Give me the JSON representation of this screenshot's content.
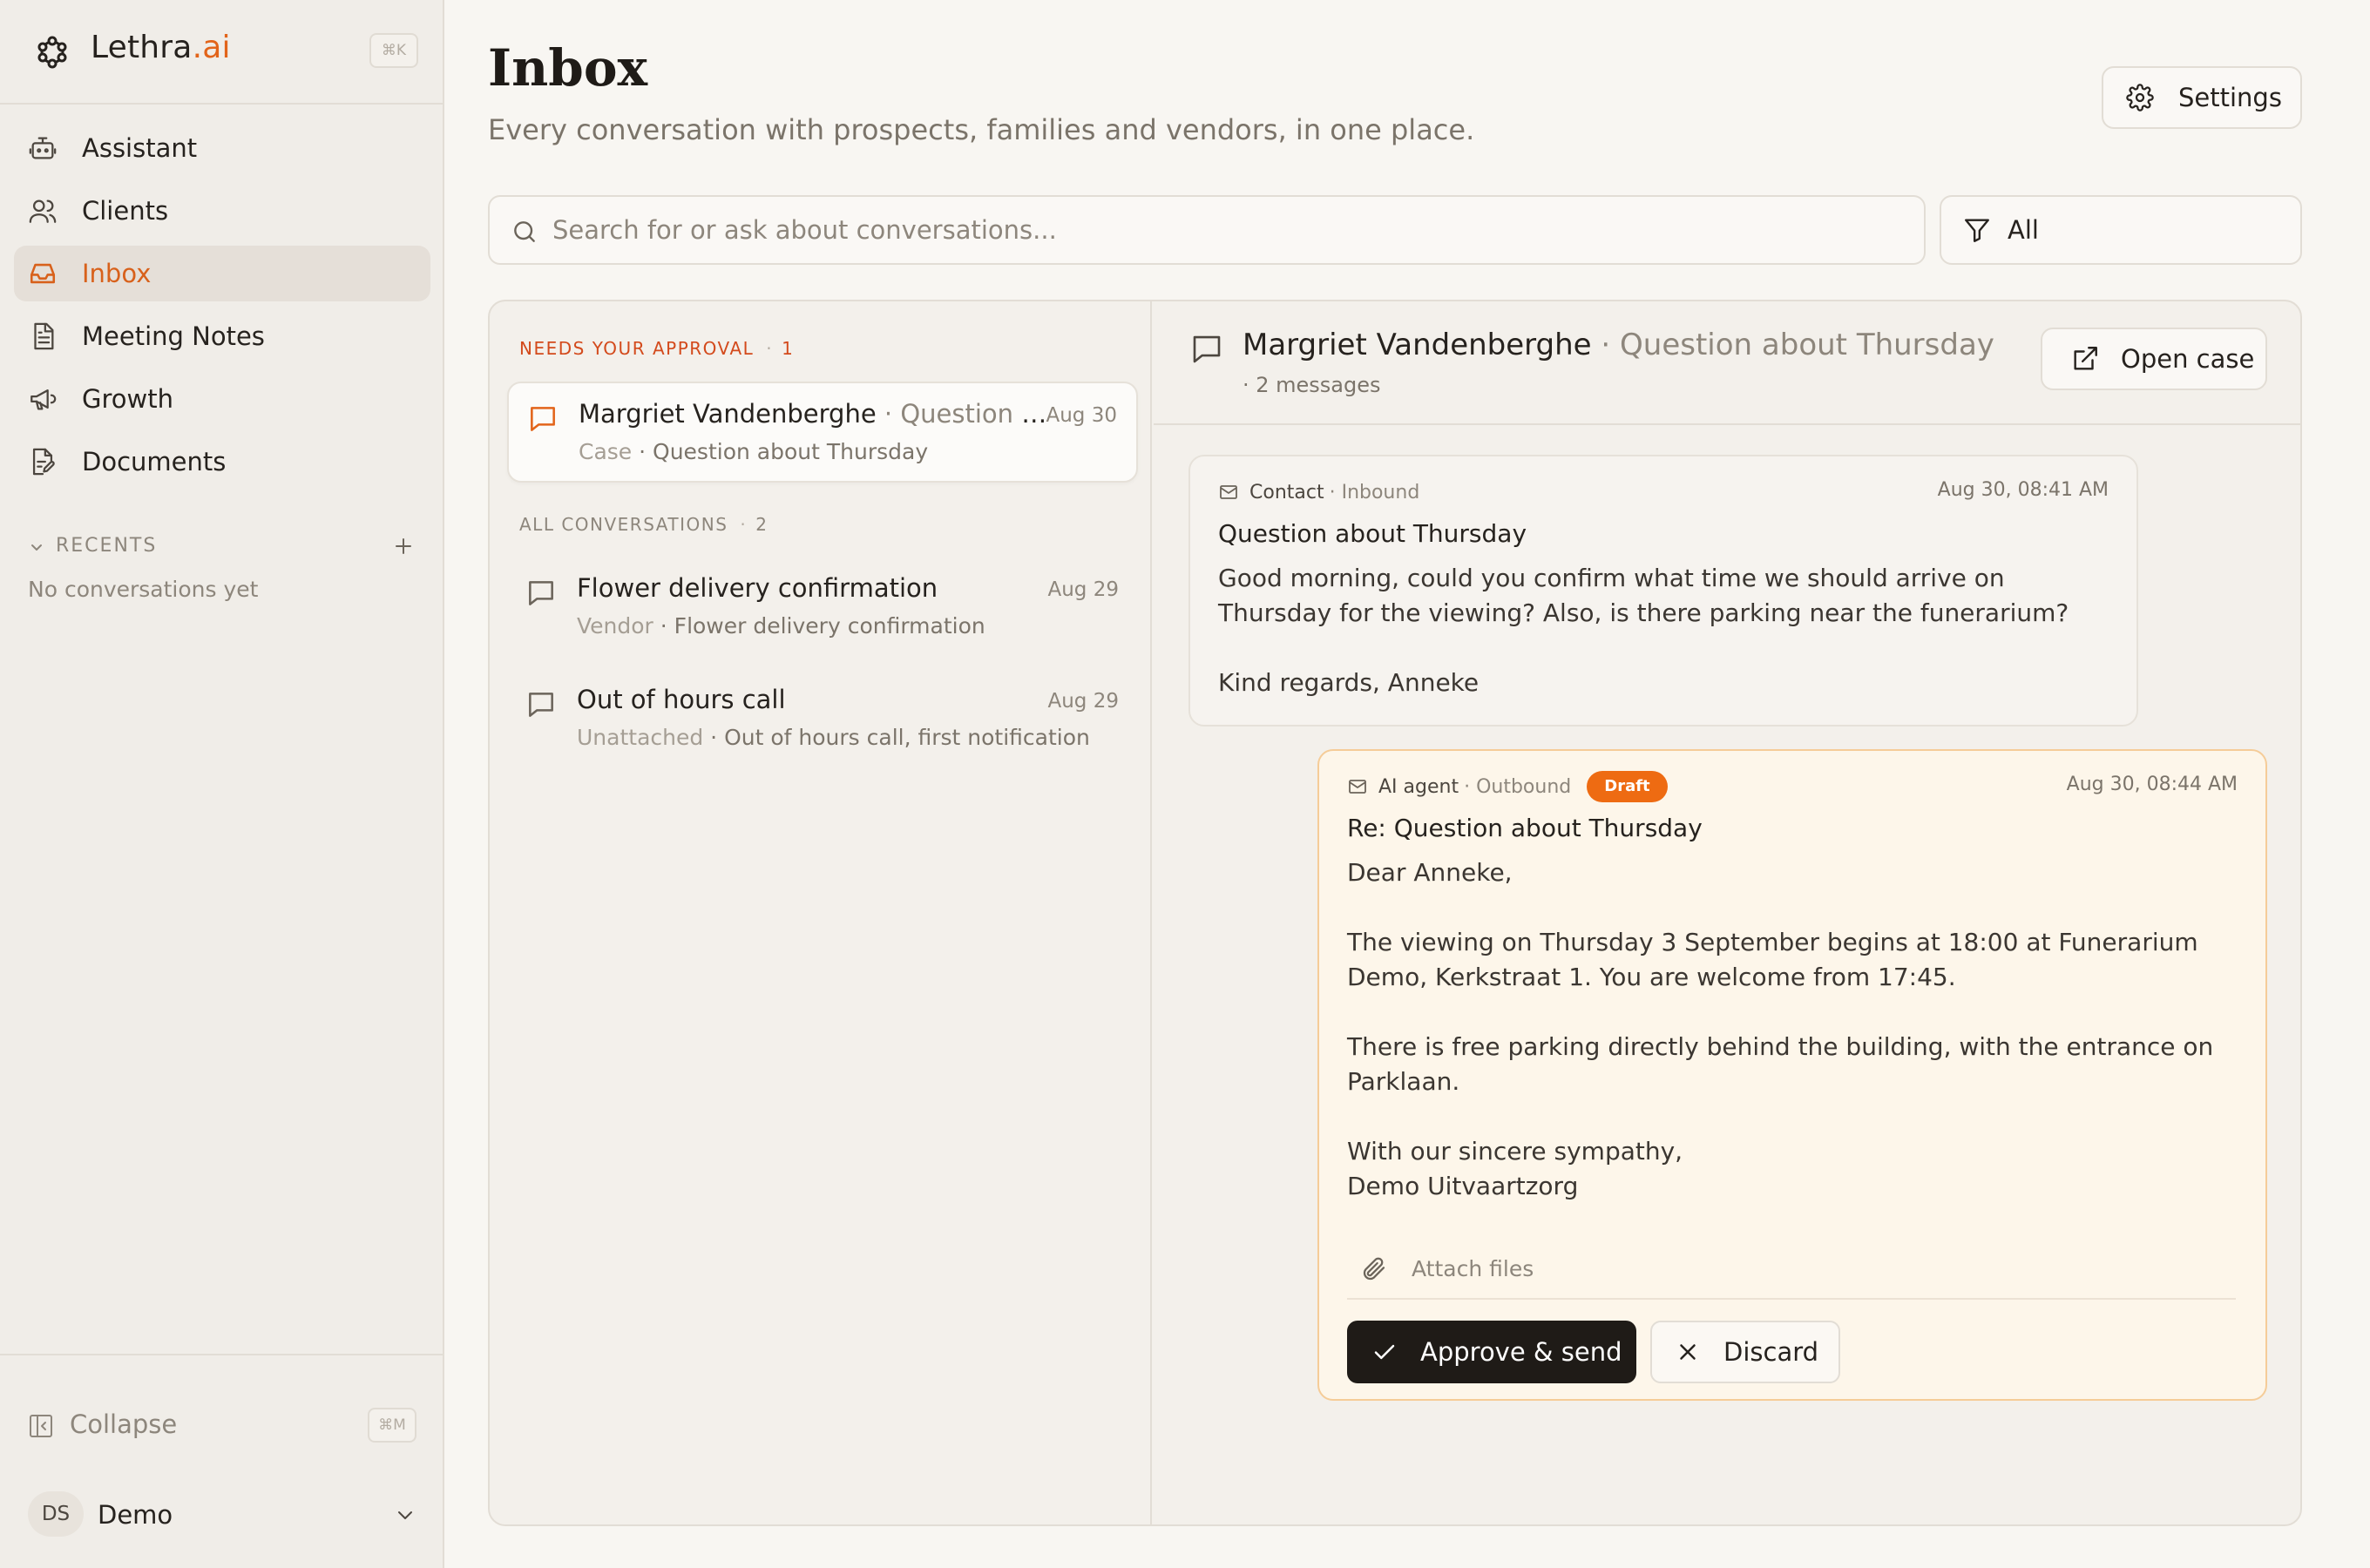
{
  "brand": {
    "name": "Lethra",
    "suffix": ".ai",
    "shortcut": "⌘K",
    "accent_color": "#e2641a"
  },
  "sidebar": {
    "items": [
      {
        "label": "Assistant",
        "icon": "bot-icon",
        "active": false
      },
      {
        "label": "Clients",
        "icon": "users-icon",
        "active": false
      },
      {
        "label": "Inbox",
        "icon": "inbox-icon",
        "active": true
      },
      {
        "label": "Meeting Notes",
        "icon": "document-icon",
        "active": false
      },
      {
        "label": "Growth",
        "icon": "megaphone-icon",
        "active": false
      },
      {
        "label": "Documents",
        "icon": "file-edit-icon",
        "active": false
      }
    ],
    "recents_label": "RECENTS",
    "recents_empty": "No conversations yet",
    "collapse_label": "Collapse",
    "collapse_shortcut": "⌘M",
    "user": {
      "initials": "DS",
      "name": "Demo"
    }
  },
  "header": {
    "title": "Inbox",
    "subtitle": "Every conversation with prospects, families and vendors, in one place.",
    "settings_label": "Settings"
  },
  "search": {
    "placeholder": "Search for or ask about conversations...",
    "value": ""
  },
  "filter": {
    "selected": "All"
  },
  "list": {
    "approval_label": "NEEDS YOUR APPROVAL",
    "approval_sep": "·",
    "approval_count": "1",
    "all_label": "ALL CONVERSATIONS",
    "all_sep": "·",
    "all_count": "2",
    "approval_items": [
      {
        "title": "Margriet Vandenberghe",
        "title_suffix": " · Question about Thursday",
        "date": "Aug 30",
        "type": "Case",
        "sub": " · Question about Thursday"
      }
    ],
    "items": [
      {
        "title": "Flower delivery confirmation",
        "date": "Aug 29",
        "type": "Vendor",
        "sub": " · Flower delivery confirmation"
      },
      {
        "title": "Out of hours call",
        "date": "Aug 29",
        "type": "Unattached",
        "sub": " · Out of hours call, first notification"
      }
    ]
  },
  "detail": {
    "name": "Margriet Vandenberghe",
    "subject_suffix": " · Question about Thursday",
    "message_count": "· 2 messages",
    "open_case_label": "Open case",
    "messages": [
      {
        "from": "Contact",
        "direction": "· Inbound",
        "time": "Aug 30, 08:41 AM",
        "subject": "Question about Thursday",
        "body": "Good morning, could you confirm what time we should arrive on Thursday for the viewing? Also, is there parking near the funerarium?\n\nKind regards, Anneke"
      },
      {
        "from": "AI agent",
        "direction": "· Outbound",
        "badge": "Draft",
        "time": "Aug 30, 08:44 AM",
        "subject": "Re: Question about Thursday",
        "body": "Dear Anneke,\n\nThe viewing on Thursday 3 September begins at 18:00 at Funerarium Demo, Kerkstraat 1. You are welcome from 17:45.\n\nThere is free parking directly behind the building, with the entrance on Parklaan.\n\nWith our sincere sympathy,\nDemo Uitvaartzorg",
        "attach_label": "Attach files",
        "approve_label": "Approve & send",
        "discard_label": "Discard"
      }
    ]
  },
  "colors": {
    "accent": "#e2641a",
    "draft_badge": "#ee6b12",
    "approval_label": "#d34a1c",
    "primary_button": "#1f1b17"
  }
}
